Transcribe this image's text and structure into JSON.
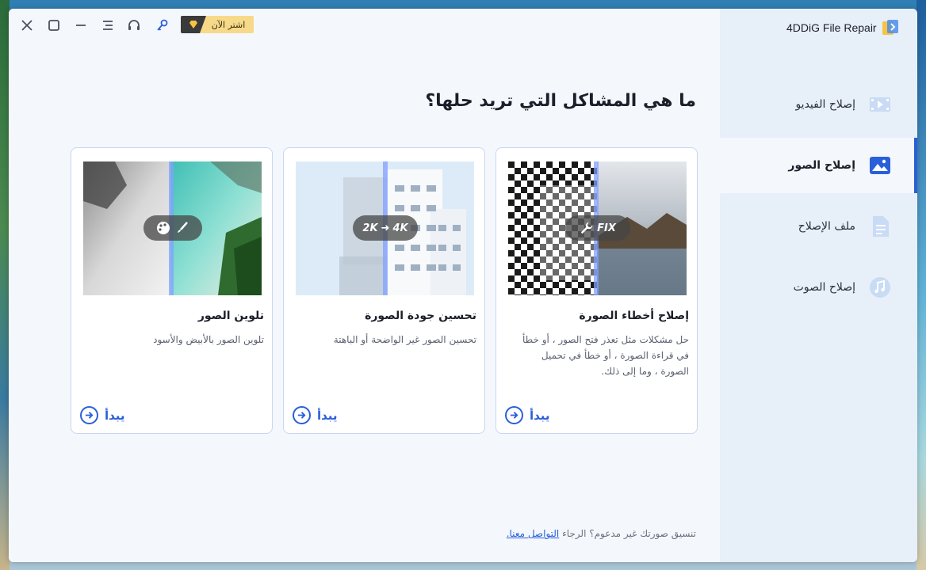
{
  "app": {
    "title": "4DDiG File Repair"
  },
  "titlebar": {
    "buy_label": "اشتر الآن"
  },
  "main": {
    "heading": "ما هي المشاكل التي تريد حلها؟",
    "cards": [
      {
        "title": "إصلاح أخطاء الصورة",
        "desc": "حل مشكلات مثل تعذر فتح الصور ، أو خطأ في قراءة الصورة ، أو خطأ في تحميل الصورة ، وما إلى ذلك.",
        "badge": "FIX",
        "start": "يبدأ"
      },
      {
        "title": "تحسين جودة الصورة",
        "desc": "تحسين الصور غير الواضحة أو الباهتة",
        "badge_from": "2K",
        "badge_to": "4K",
        "start": "يبدأ"
      },
      {
        "title": "تلوين الصور",
        "desc": "تلوين الصور بالأبيض والأسود",
        "start": "يبدأ"
      }
    ],
    "footer_text": "تنسيق صورتك غير مدعوم؟ الرجاء",
    "footer_link": "التواصل معنا."
  },
  "sidebar": {
    "items": [
      {
        "label": "إصلاح الفيديو",
        "icon": "video-icon"
      },
      {
        "label": "إصلاح الصور",
        "icon": "photo-icon"
      },
      {
        "label": "ملف الإصلاح",
        "icon": "file-icon"
      },
      {
        "label": "إصلاح الصوت",
        "icon": "audio-icon"
      }
    ]
  },
  "colors": {
    "accent": "#2a5fd9",
    "sidebar_bg": "#e7eff9",
    "main_bg": "#f4f8fd"
  }
}
